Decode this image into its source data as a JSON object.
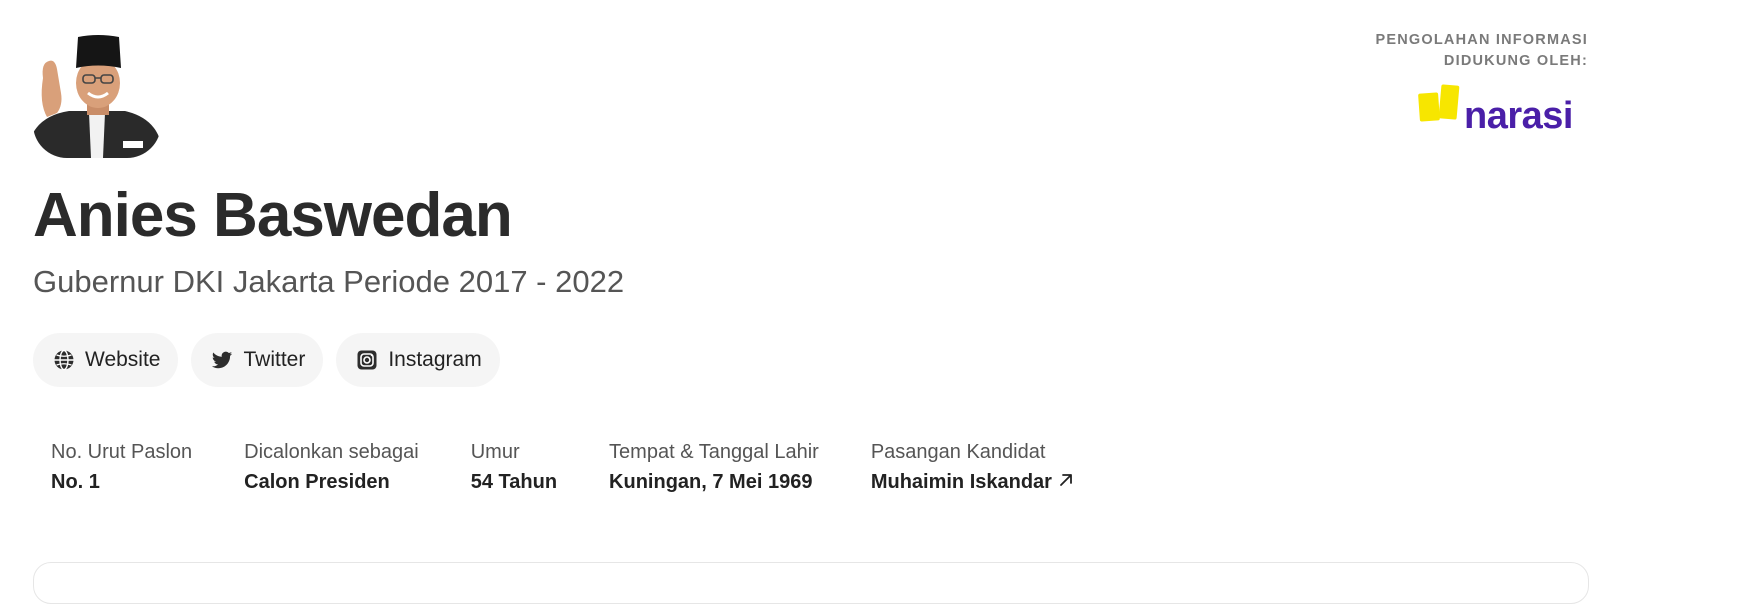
{
  "candidate": {
    "name": "Anies Baswedan",
    "subtitle": "Gubernur DKI Jakarta Periode 2017 - 2022"
  },
  "links": [
    {
      "label": "Website",
      "icon": "globe-icon"
    },
    {
      "label": "Twitter",
      "icon": "twitter-icon"
    },
    {
      "label": "Instagram",
      "icon": "instagram-icon"
    }
  ],
  "facts": [
    {
      "label": "No. Urut Paslon",
      "value": "No. 1"
    },
    {
      "label": "Dicalonkan sebagai",
      "value": "Calon Presiden"
    },
    {
      "label": "Umur",
      "value": "54 Tahun"
    },
    {
      "label": "Tempat & Tanggal Lahir",
      "value": "Kuningan, 7 Mei 1969"
    },
    {
      "label": "Pasangan Kandidat",
      "value": "Muhaimin Iskandar",
      "icon": "arrow-up-right-icon"
    }
  ],
  "sponsor": {
    "line1": "PENGOLAHAN INFORMASI",
    "line2": "DIDUKUNG OLEH:",
    "logo_text": "narasi"
  },
  "colors": {
    "brand_purple": "#4a1fa8",
    "brand_yellow": "#f7e600",
    "chip_bg": "#f5f5f5",
    "heading": "#2b2b2b"
  }
}
